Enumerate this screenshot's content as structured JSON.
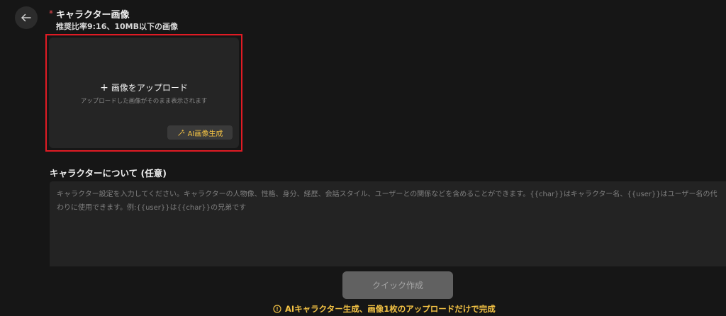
{
  "colors": {
    "background": "#161616",
    "panel": "#252525",
    "accent": "#f3c244",
    "required": "#e5484d",
    "highlight": "#e01b24"
  },
  "header": {
    "back_icon": "arrow-left-icon"
  },
  "character_image": {
    "required_mark": "*",
    "title": "キャラクター画像",
    "hint": "推奨比率9:16、10MB以下の画像",
    "upload": {
      "icon": "plus-icon",
      "label": "画像をアップロード",
      "sub_label": "アップロードした画像がそのまま表示されます"
    },
    "ai_image_button": {
      "icon": "magic-wand-icon",
      "label": "AI画像生成"
    }
  },
  "about": {
    "title": "キャラクターについて (任意)",
    "value": "",
    "placeholder": "キャラクター設定を入力してください。キャラクターの人物像、性格、身分、経歴、会話スタイル、ユーザーとの関係などを含めることができます。{{char}}はキャラクター名、{{user}}はユーザー名の代わりに使用できます。例:{{user}}は{{char}}の兄弟です"
  },
  "actions": {
    "quick_create_label": "クイック作成",
    "notice_icon": "info-circle-icon",
    "notice": "AIキャラクター生成、画像1枚のアップロードだけで完成"
  }
}
